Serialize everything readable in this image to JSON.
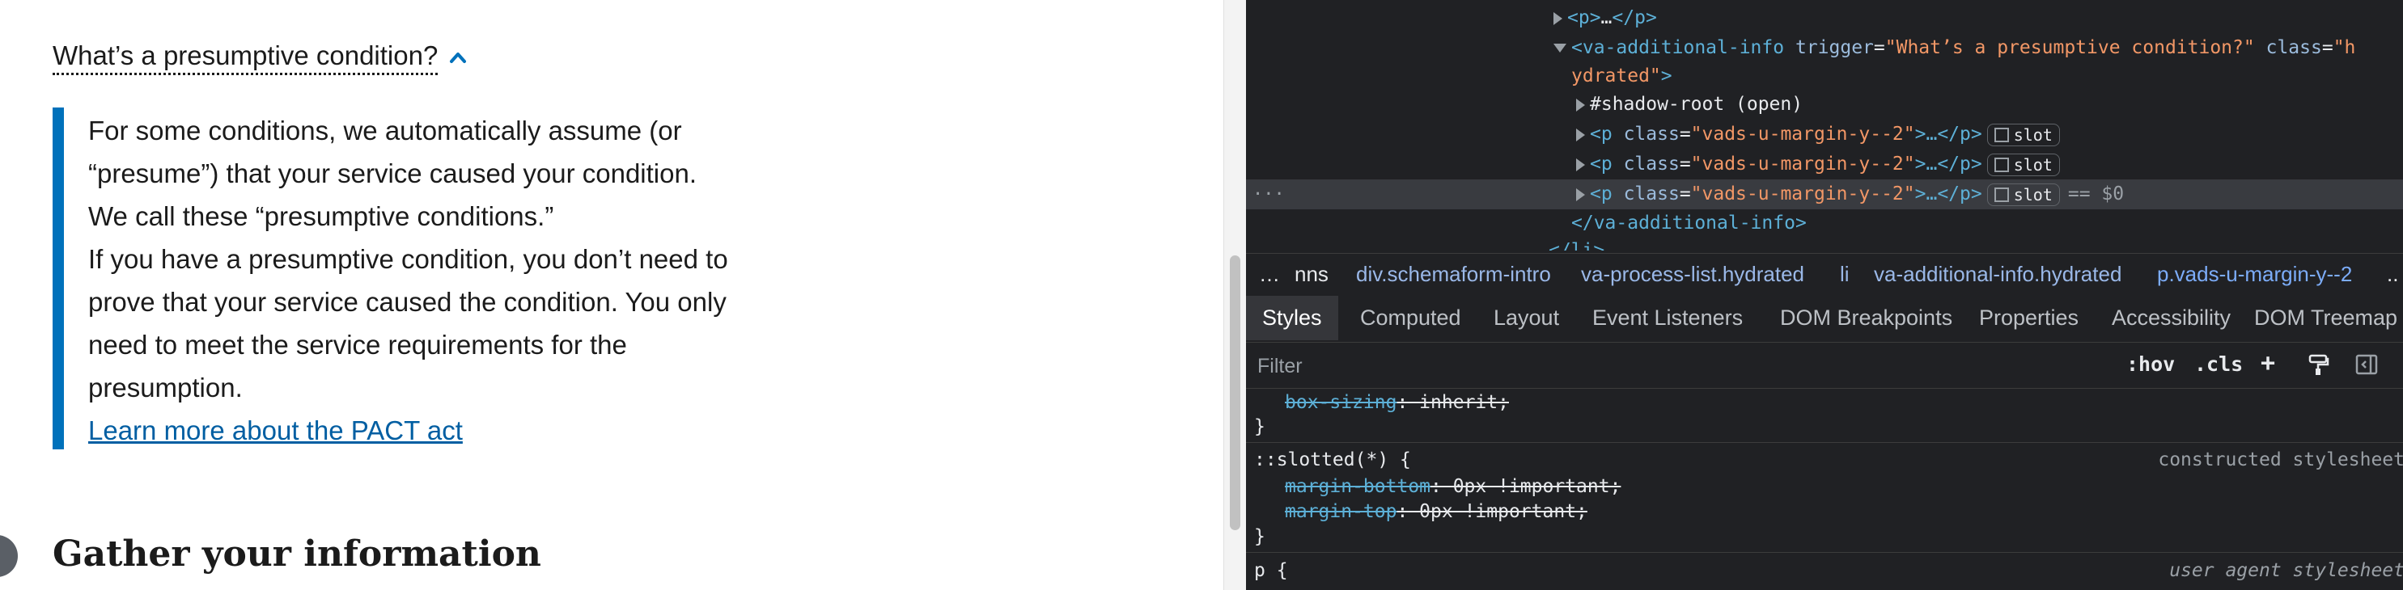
{
  "page": {
    "trigger_text": "What’s a presumptive condition?",
    "info_paragraphs": [
      "For some conditions, we automatically assume (or “presume”) that your service caused your condition. We call these “presumptive conditions.”",
      "If you have a presumptive condition, you don’t need to prove that your service caused the condition. You only need to meet the service requirements for the presumption."
    ],
    "learn_more_link": "Learn more about the PACT act",
    "next_heading": "Gather your information",
    "colors": {
      "info_bar": "#0071bb",
      "link": "#005ea2",
      "chevron": "#0071bb"
    },
    "icons": [
      "chevron-up-icon"
    ]
  },
  "devtools": {
    "dom": {
      "line_p": {
        "open": "<p>",
        "ellipsis": "…",
        "close": "</p>"
      },
      "line_va": {
        "open": "<va-additional-info",
        "attr1_name": "trigger",
        "attr1_value": "\"What’s a presumptive condition?\"",
        "attr2_name": "class",
        "attr2_value_part1": "\"h",
        "attr2_value_part2": "ydrated\"",
        "close_bracket": ">"
      },
      "shadow_root": "#shadow-root (open)",
      "p_class_rows": [
        {
          "open": "<p",
          "attr_name": "class",
          "attr_value": "\"vads-u-margin-y--2\"",
          "mid": ">…</p>",
          "badge": "slot"
        },
        {
          "open": "<p",
          "attr_name": "class",
          "attr_value": "\"vads-u-margin-y--2\"",
          "mid": ">…</p>",
          "badge": "slot"
        },
        {
          "open": "<p",
          "attr_name": "class",
          "attr_value": "\"vads-u-margin-y--2\"",
          "mid": ">…</p>",
          "badge": "slot"
        }
      ],
      "selected_suffix": "== $0",
      "gutter_dots": "···",
      "closing_tag": "</va-additional-info>",
      "cut_tag": "</li>"
    },
    "breadcrumbs": {
      "more": "…",
      "items": [
        "nns",
        "div.schemaform-intro",
        "va-process-list.hydrated",
        "li",
        "va-additional-info.hydrated",
        "p.vads-u-margin-y--2"
      ],
      "trailing": ".."
    },
    "tabs": [
      "Styles",
      "Computed",
      "Layout",
      "Event Listeners",
      "DOM Breakpoints",
      "Properties",
      "Accessibility",
      "DOM Treemap"
    ],
    "filter": {
      "placeholder": "Filter",
      "hov": ":hov",
      "cls": ".cls",
      "plus": "+"
    },
    "styles": {
      "box_sizing_prop": "box-sizing",
      "box_sizing_val": ": inherit;",
      "close_brace_1": "}",
      "selector_slotted": "::slotted(*) {",
      "source_constructed": "constructed stylesheet",
      "margin_bottom_prop": "margin-bottom",
      "margin_bottom_val": ": 0px !important;",
      "margin_top_prop": "margin-top",
      "margin_top_val": ": 0px !important;",
      "close_brace_2": "}",
      "selector_p": "p {",
      "source_ua": "user agent stylesheet"
    }
  }
}
